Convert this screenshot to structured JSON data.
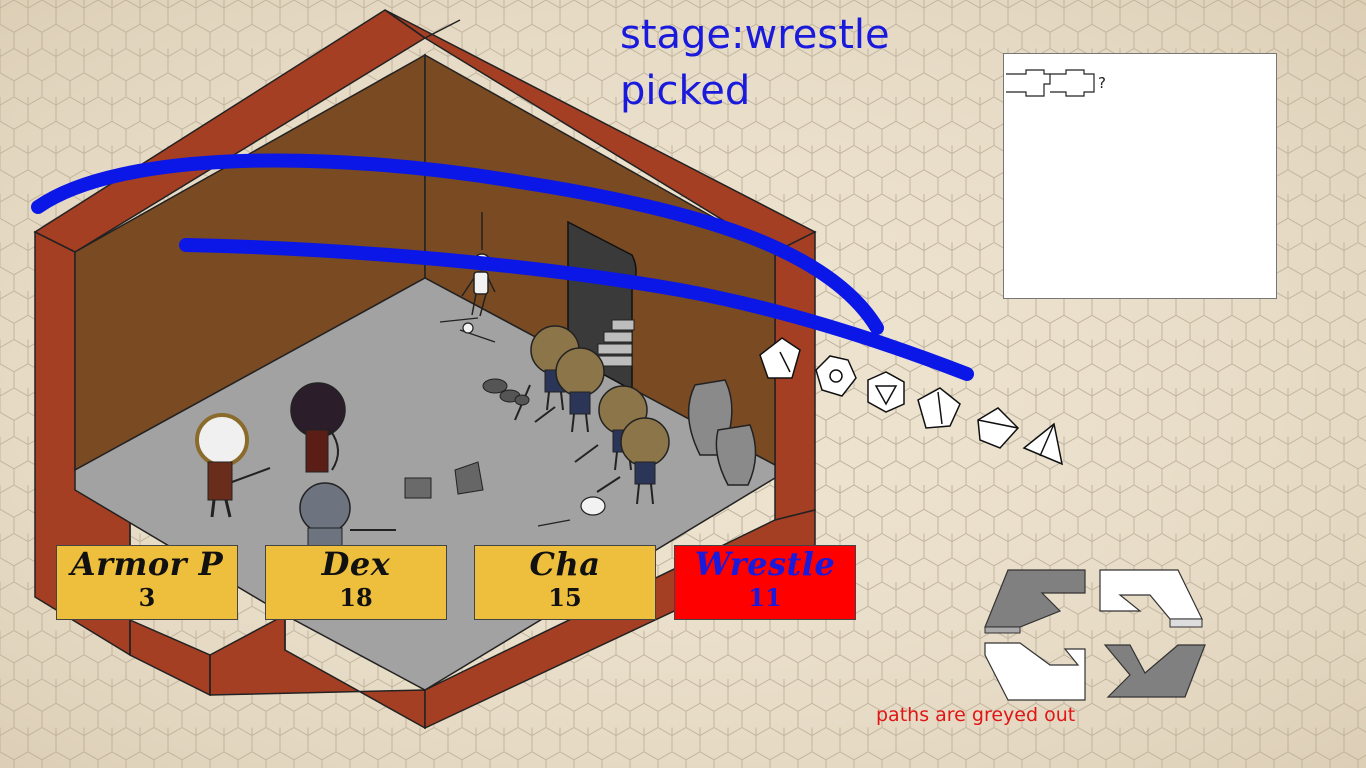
{
  "stage": {
    "label": "stage:wrestle",
    "status": "picked"
  },
  "stats": [
    {
      "name": "Armor P",
      "value": "3",
      "selected": false
    },
    {
      "name": "Dex",
      "value": "18",
      "selected": false
    },
    {
      "name": "Cha",
      "value": "15",
      "selected": false
    },
    {
      "name": "Wrestle",
      "value": "11",
      "selected": true
    }
  ],
  "log_panel": {
    "text": "?"
  },
  "dice": [
    "d10",
    "d12",
    "d20",
    "d10-percentile",
    "d8",
    "d4"
  ],
  "nav": {
    "arrows": [
      {
        "direction": "up-left",
        "state": "greyed"
      },
      {
        "direction": "up-right",
        "state": "available"
      },
      {
        "direction": "down-left",
        "state": "available"
      },
      {
        "direction": "down-right",
        "state": "greyed"
      }
    ],
    "note": "paths are greyed out"
  },
  "colors": {
    "stage_text": "#1a1adc",
    "stat_card": "#eebf3c",
    "stat_card_selected": "#ff0000",
    "wall_outer": "#a53f24",
    "wall_inner": "#7a4a22",
    "floor": "#a0a0a0",
    "path_stroke": "#0a17e6",
    "note_text": "#e01515"
  }
}
